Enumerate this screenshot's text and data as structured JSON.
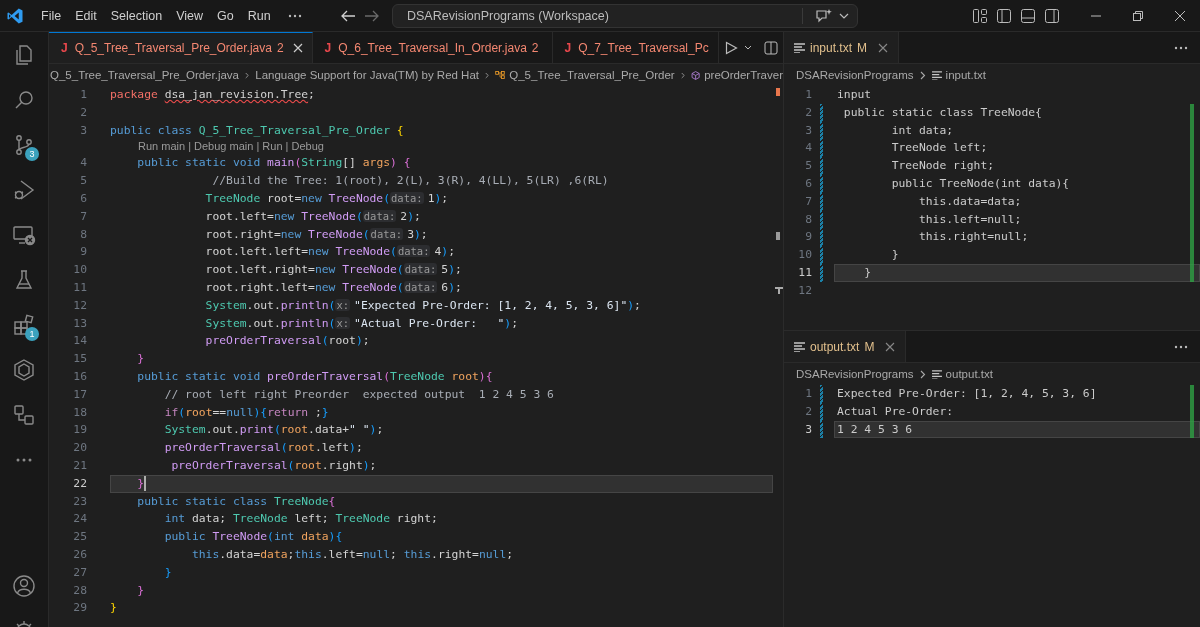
{
  "title_bar": {
    "menus": [
      "File",
      "Edit",
      "Selection",
      "View",
      "Go",
      "Run"
    ],
    "nav": [
      {
        "kind": "back",
        "disabled": false
      },
      {
        "kind": "forward",
        "disabled": true
      }
    ],
    "command_center": "DSARevisionPrograms (Workspace)"
  },
  "activity_bar": {
    "items": [
      {
        "kind": "explorer"
      },
      {
        "kind": "search"
      },
      {
        "kind": "source-control",
        "badge": "3"
      },
      {
        "kind": "run-debug"
      },
      {
        "kind": "remote"
      },
      {
        "kind": "testing"
      },
      {
        "kind": "extensions",
        "badge": "1"
      },
      {
        "kind": "hexagon"
      },
      {
        "kind": "diagram"
      },
      {
        "kind": "more"
      }
    ],
    "bottom_items": [
      {
        "kind": "account"
      },
      {
        "kind": "settings"
      }
    ]
  },
  "editor": {
    "tabs": [
      {
        "icon": "J",
        "label": "Q_5_Tree_Traversal_Pre_Order.java",
        "badge": "2",
        "errors": true,
        "selected": true
      },
      {
        "icon": "J",
        "label": "Q_6_Tree_Traversal_In_Order.java",
        "badge": "2",
        "errors": true,
        "selected": false
      },
      {
        "icon": "J",
        "label": "Q_7_Tree_Traversal_Pc",
        "errors": true,
        "selected": false
      }
    ],
    "breadcrumbs": [
      {
        "kind": "file",
        "text": "Q_5_Tree_Traversal_Pre_Order.java"
      },
      {
        "kind": "plain",
        "text": "Language Support for Java(TM) by Red Hat"
      },
      {
        "kind": "class",
        "text": "Q_5_Tree_Traversal_Pre_Order"
      },
      {
        "kind": "method",
        "text": "preOrderTraver"
      }
    ],
    "lines": [
      {
        "kind": "code",
        "n": "1",
        "current": false,
        "tokens": [
          {
            "kind": "package",
            "text": "package "
          },
          {
            "kind": "error",
            "text": "dsa_jan_revision.Tree"
          },
          {
            "kind": "plain",
            "text": ";"
          }
        ]
      },
      {
        "kind": "code",
        "n": "2",
        "current": false
      },
      {
        "kind": "code",
        "n": "3",
        "current": false,
        "tokens": [
          {
            "kind": "keyword",
            "text": "public class "
          },
          {
            "kind": "type",
            "text": "Q_5_Tree_Traversal_Pre_Order "
          },
          {
            "kind": "b1",
            "text": "{"
          }
        ]
      },
      {
        "kind": "codelens",
        "text": "Run main | Debug main | Run | Debug"
      },
      {
        "kind": "code",
        "n": "4",
        "current": false,
        "tokens": [
          {
            "kind": "keyword",
            "text": "    public static void "
          },
          {
            "kind": "function",
            "text": "main"
          },
          {
            "kind": "b2",
            "text": "("
          },
          {
            "kind": "type",
            "text": "String"
          },
          {
            "kind": "plain",
            "text": "[] "
          },
          {
            "kind": "param",
            "text": "args"
          },
          {
            "kind": "b2",
            "text": ") {"
          }
        ]
      },
      {
        "kind": "code",
        "n": "5",
        "current": false,
        "tokens": [
          {
            "kind": "comment",
            "text": "               //Build the Tree: 1(root), 2(L), 3(R), 4(LL), 5(LR) ,6(RL)"
          }
        ]
      },
      {
        "kind": "code",
        "n": "6",
        "current": false,
        "tokens": [
          {
            "kind": "type",
            "text": "              TreeNode"
          },
          {
            "kind": "plain",
            "text": " root="
          },
          {
            "kind": "keyword",
            "text": "new "
          },
          {
            "kind": "function",
            "text": "TreeNode"
          },
          {
            "kind": "b3",
            "text": "("
          },
          {
            "kind": "hint",
            "text": "data:"
          },
          {
            "kind": "number",
            "text": "1"
          },
          {
            "kind": "b3",
            "text": ")"
          },
          {
            "kind": "plain",
            "text": ";"
          }
        ]
      },
      {
        "kind": "code",
        "n": "7",
        "current": false,
        "tokens": [
          {
            "kind": "plain",
            "text": "              root.left="
          },
          {
            "kind": "keyword",
            "text": "new "
          },
          {
            "kind": "function",
            "text": "TreeNode"
          },
          {
            "kind": "b3",
            "text": "("
          },
          {
            "kind": "hint",
            "text": "data:"
          },
          {
            "kind": "number",
            "text": "2"
          },
          {
            "kind": "b3",
            "text": ")"
          },
          {
            "kind": "plain",
            "text": ";"
          }
        ]
      },
      {
        "kind": "code",
        "n": "8",
        "current": false,
        "tokens": [
          {
            "kind": "plain",
            "text": "              root.right="
          },
          {
            "kind": "keyword",
            "text": "new "
          },
          {
            "kind": "function",
            "text": "TreeNode"
          },
          {
            "kind": "b3",
            "text": "("
          },
          {
            "kind": "hint",
            "text": "data:"
          },
          {
            "kind": "number",
            "text": "3"
          },
          {
            "kind": "b3",
            "text": ")"
          },
          {
            "kind": "plain",
            "text": ";"
          }
        ]
      },
      {
        "kind": "code",
        "n": "9",
        "current": false,
        "tokens": [
          {
            "kind": "plain",
            "text": "              root.left.left="
          },
          {
            "kind": "keyword",
            "text": "new "
          },
          {
            "kind": "function",
            "text": "TreeNode"
          },
          {
            "kind": "b3",
            "text": "("
          },
          {
            "kind": "hint",
            "text": "data:"
          },
          {
            "kind": "number",
            "text": "4"
          },
          {
            "kind": "b3",
            "text": ")"
          },
          {
            "kind": "plain",
            "text": ";"
          }
        ]
      },
      {
        "kind": "code",
        "n": "10",
        "current": false,
        "tokens": [
          {
            "kind": "plain",
            "text": "              root.left.right="
          },
          {
            "kind": "keyword",
            "text": "new "
          },
          {
            "kind": "function",
            "text": "TreeNode"
          },
          {
            "kind": "b3",
            "text": "("
          },
          {
            "kind": "hint",
            "text": "data:"
          },
          {
            "kind": "number",
            "text": "5"
          },
          {
            "kind": "b3",
            "text": ")"
          },
          {
            "kind": "plain",
            "text": ";"
          }
        ]
      },
      {
        "kind": "code",
        "n": "11",
        "current": false,
        "tokens": [
          {
            "kind": "plain",
            "text": "              root.right.left="
          },
          {
            "kind": "keyword",
            "text": "new "
          },
          {
            "kind": "function",
            "text": "TreeNode"
          },
          {
            "kind": "b3",
            "text": "("
          },
          {
            "kind": "hint",
            "text": "data:"
          },
          {
            "kind": "number",
            "text": "6"
          },
          {
            "kind": "b3",
            "text": ")"
          },
          {
            "kind": "plain",
            "text": ";"
          }
        ]
      },
      {
        "kind": "code",
        "n": "12",
        "current": false,
        "tokens": [
          {
            "kind": "type",
            "text": "              System"
          },
          {
            "kind": "plain",
            "text": ".out."
          },
          {
            "kind": "function",
            "text": "println"
          },
          {
            "kind": "b3",
            "text": "("
          },
          {
            "kind": "hint",
            "text": "x:"
          },
          {
            "kind": "string",
            "text": "\"Expected Pre-Order: [1, 2, 4, 5, 3, 6]\""
          },
          {
            "kind": "b3",
            "text": ")"
          },
          {
            "kind": "plain",
            "text": ";"
          }
        ]
      },
      {
        "kind": "code",
        "n": "13",
        "current": false,
        "tokens": [
          {
            "kind": "type",
            "text": "              System"
          },
          {
            "kind": "plain",
            "text": ".out."
          },
          {
            "kind": "function",
            "text": "println"
          },
          {
            "kind": "b3",
            "text": "("
          },
          {
            "kind": "hint",
            "text": "x:"
          },
          {
            "kind": "string",
            "text": "\"Actual Pre-Order:   \""
          },
          {
            "kind": "b3",
            "text": ")"
          },
          {
            "kind": "plain",
            "text": ";"
          }
        ]
      },
      {
        "kind": "code",
        "n": "14",
        "current": false,
        "tokens": [
          {
            "kind": "function",
            "text": "              preOrderTraversal"
          },
          {
            "kind": "b3",
            "text": "("
          },
          {
            "kind": "plain",
            "text": "root"
          },
          {
            "kind": "b3",
            "text": ")"
          },
          {
            "kind": "plain",
            "text": ";"
          }
        ]
      },
      {
        "kind": "code",
        "n": "15",
        "current": false,
        "tokens": [
          {
            "kind": "b2",
            "text": "    }"
          }
        ]
      },
      {
        "kind": "code",
        "n": "16",
        "current": false,
        "tokens": [
          {
            "kind": "keyword",
            "text": "    public static void "
          },
          {
            "kind": "function",
            "text": "preOrderTraversal"
          },
          {
            "kind": "b2",
            "text": "("
          },
          {
            "kind": "type",
            "text": "TreeNode "
          },
          {
            "kind": "param",
            "text": "root"
          },
          {
            "kind": "b2",
            "text": "){"
          }
        ]
      },
      {
        "kind": "code",
        "n": "17",
        "current": false,
        "tokens": [
          {
            "kind": "comment",
            "text": "        // root left right Preorder  expected output  1 2 4 5 3 6"
          }
        ]
      },
      {
        "kind": "code",
        "n": "18",
        "current": false,
        "tokens": [
          {
            "kind": "control",
            "text": "        if"
          },
          {
            "kind": "b3",
            "text": "("
          },
          {
            "kind": "param",
            "text": "root"
          },
          {
            "kind": "plain",
            "text": "=="
          },
          {
            "kind": "keyword",
            "text": "null"
          },
          {
            "kind": "b3",
            "text": "){"
          },
          {
            "kind": "control",
            "text": "return"
          },
          {
            "kind": "plain",
            "text": " ;"
          },
          {
            "kind": "b3",
            "text": "}"
          }
        ]
      },
      {
        "kind": "code",
        "n": "19",
        "current": false,
        "tokens": [
          {
            "kind": "type",
            "text": "        System"
          },
          {
            "kind": "plain",
            "text": ".out."
          },
          {
            "kind": "function",
            "text": "print"
          },
          {
            "kind": "b3",
            "text": "("
          },
          {
            "kind": "param",
            "text": "root"
          },
          {
            "kind": "plain",
            "text": ".data+"
          },
          {
            "kind": "string",
            "text": "\" \""
          },
          {
            "kind": "b3",
            "text": ")"
          },
          {
            "kind": "plain",
            "text": ";"
          }
        ]
      },
      {
        "kind": "code",
        "n": "20",
        "current": false,
        "tokens": [
          {
            "kind": "function",
            "text": "        preOrderTraversal"
          },
          {
            "kind": "b3",
            "text": "("
          },
          {
            "kind": "param",
            "text": "root"
          },
          {
            "kind": "plain",
            "text": ".left"
          },
          {
            "kind": "b3",
            "text": ")"
          },
          {
            "kind": "plain",
            "text": ";"
          }
        ]
      },
      {
        "kind": "code",
        "n": "21",
        "current": false,
        "tokens": [
          {
            "kind": "function",
            "text": "         preOrderTraversal"
          },
          {
            "kind": "b3",
            "text": "("
          },
          {
            "kind": "param",
            "text": "root"
          },
          {
            "kind": "plain",
            "text": ".right"
          },
          {
            "kind": "b3",
            "text": ")"
          },
          {
            "kind": "plain",
            "text": ";"
          }
        ]
      },
      {
        "kind": "code",
        "n": "22",
        "current": true,
        "tokens": [
          {
            "kind": "b2",
            "text": "    }"
          }
        ]
      },
      {
        "kind": "code",
        "n": "23",
        "current": false,
        "tokens": [
          {
            "kind": "keyword",
            "text": "    public static class "
          },
          {
            "kind": "type",
            "text": "TreeNode"
          },
          {
            "kind": "b2",
            "text": "{"
          }
        ]
      },
      {
        "kind": "code",
        "n": "24",
        "current": false,
        "tokens": [
          {
            "kind": "keyword",
            "text": "        int"
          },
          {
            "kind": "plain",
            "text": " data; "
          },
          {
            "kind": "type",
            "text": "TreeNode"
          },
          {
            "kind": "plain",
            "text": " left; "
          },
          {
            "kind": "type",
            "text": "TreeNode"
          },
          {
            "kind": "plain",
            "text": " right;"
          }
        ]
      },
      {
        "kind": "code",
        "n": "25",
        "current": false,
        "tokens": [
          {
            "kind": "keyword",
            "text": "        public "
          },
          {
            "kind": "function",
            "text": "TreeNode"
          },
          {
            "kind": "b3",
            "text": "("
          },
          {
            "kind": "keyword",
            "text": "int "
          },
          {
            "kind": "param",
            "text": "data"
          },
          {
            "kind": "b3",
            "text": "){"
          }
        ]
      },
      {
        "kind": "code",
        "n": "26",
        "current": false,
        "tokens": [
          {
            "kind": "keyword",
            "text": "            this"
          },
          {
            "kind": "plain",
            "text": ".data="
          },
          {
            "kind": "param",
            "text": "data"
          },
          {
            "kind": "plain",
            "text": ";"
          },
          {
            "kind": "keyword",
            "text": "this"
          },
          {
            "kind": "plain",
            "text": ".left="
          },
          {
            "kind": "keyword",
            "text": "null"
          },
          {
            "kind": "plain",
            "text": "; "
          },
          {
            "kind": "keyword",
            "text": "this"
          },
          {
            "kind": "plain",
            "text": ".right="
          },
          {
            "kind": "keyword",
            "text": "null"
          },
          {
            "kind": "plain",
            "text": ";"
          }
        ]
      },
      {
        "kind": "code",
        "n": "27",
        "current": false,
        "tokens": [
          {
            "kind": "b3",
            "text": "        }"
          }
        ]
      },
      {
        "kind": "code",
        "n": "28",
        "current": false,
        "tokens": [
          {
            "kind": "b2",
            "text": "    }"
          }
        ]
      },
      {
        "kind": "code",
        "n": "29",
        "current": false,
        "tokens": [
          {
            "kind": "b1",
            "text": "}"
          }
        ]
      }
    ]
  },
  "side_editors": [
    {
      "tab": {
        "label": "input.txt",
        "status": "M",
        "selected": true
      },
      "breadcrumbs": [
        "DSARevisionPrograms",
        "input.txt"
      ],
      "lines": [
        {
          "n": "1",
          "text": "input",
          "changed": false,
          "current": false
        },
        {
          "n": "2",
          "text": " public static class TreeNode{",
          "changed": true,
          "current": false
        },
        {
          "n": "3",
          "text": "        int data;",
          "changed": true,
          "current": false
        },
        {
          "n": "4",
          "text": "        TreeNode left;",
          "changed": true,
          "current": false
        },
        {
          "n": "5",
          "text": "        TreeNode right;",
          "changed": true,
          "current": false
        },
        {
          "n": "6",
          "text": "        public TreeNode(int data){",
          "changed": true,
          "current": false
        },
        {
          "n": "7",
          "text": "            this.data=data;",
          "changed": true,
          "current": false
        },
        {
          "n": "8",
          "text": "            this.left=null;",
          "changed": true,
          "current": false
        },
        {
          "n": "9",
          "text": "            this.right=null;",
          "changed": true,
          "current": false
        },
        {
          "n": "10",
          "text": "        }",
          "changed": true,
          "current": false
        },
        {
          "n": "11",
          "text": "    }",
          "changed": true,
          "current": true
        },
        {
          "n": "12",
          "changed": false,
          "current": false
        }
      ]
    },
    {
      "tab": {
        "label": "output.txt",
        "status": "M",
        "selected": true
      },
      "breadcrumbs": [
        "DSARevisionPrograms",
        "output.txt"
      ],
      "lines": [
        {
          "n": "1",
          "text": "Expected Pre-Order: [1, 2, 4, 5, 3, 6]",
          "changed": true,
          "current": false
        },
        {
          "n": "2",
          "text": "Actual Pre-Order:",
          "changed": true,
          "current": false
        },
        {
          "n": "3",
          "text": "1 2 4 5 3 6",
          "changed": true,
          "current": true
        }
      ]
    }
  ]
}
